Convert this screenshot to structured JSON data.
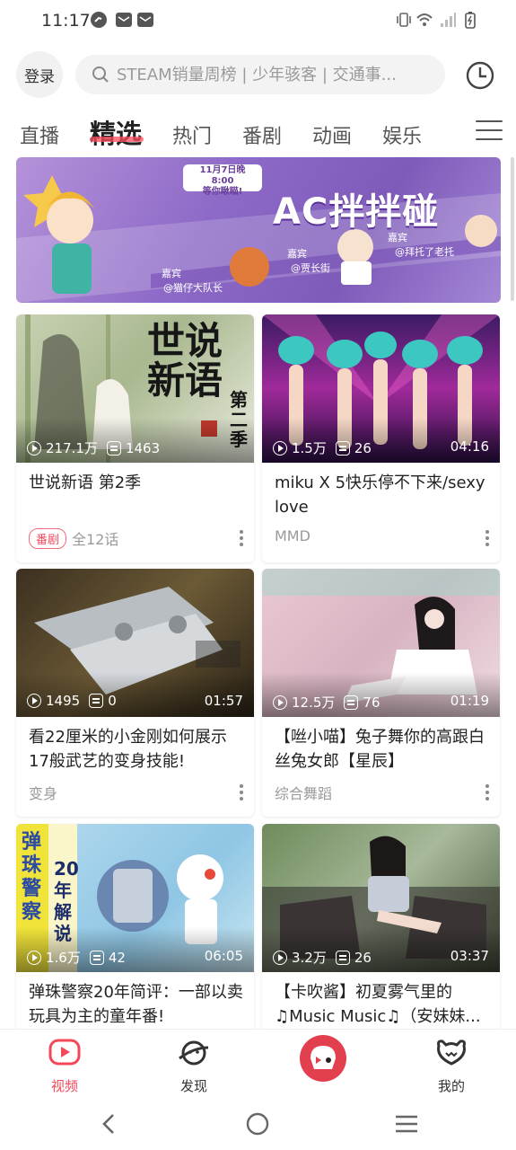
{
  "status_bar": {
    "time": "11:17"
  },
  "header": {
    "login_label": "登录",
    "search_placeholder": "STEAM销量周榜 | 少年骇客 | 交通事..."
  },
  "tabs": [
    {
      "label": "直播"
    },
    {
      "label": "精选"
    },
    {
      "label": "热门"
    },
    {
      "label": "番剧"
    },
    {
      "label": "动画"
    },
    {
      "label": "娱乐"
    }
  ],
  "banner": {
    "title": "AC拌拌碰",
    "date_text": "11月7日晚8:00\n等你瞅瞄!",
    "guest_label": "嘉宾",
    "guests": [
      "@猫仔大队长",
      "@贾长街",
      "@拜托了老托"
    ]
  },
  "cards": [
    {
      "title": "世说新语 第2季",
      "views": "217.1万",
      "danmaku": "1463",
      "duration": "",
      "badge": "番剧",
      "meta": "全12话",
      "thumb_text": "世说新语",
      "thumb_sub": "第二季"
    },
    {
      "title": "miku X 5快乐停不下来/sexy love",
      "views": "1.5万",
      "danmaku": "26",
      "duration": "04:16",
      "badge": "",
      "meta": "MMD"
    },
    {
      "title": "看22厘米的小金刚如何展示17般武艺的变身技能!",
      "views": "1495",
      "danmaku": "0",
      "duration": "01:57",
      "badge": "",
      "meta": "变身"
    },
    {
      "title": "【咝小喵】兔子舞你的高跟白丝兔女郎【星辰】",
      "views": "12.5万",
      "danmaku": "76",
      "duration": "01:19",
      "badge": "",
      "meta": "综合舞蹈"
    },
    {
      "title": "弹珠警察20年简评：一部以卖玩具为主的童年番!",
      "views": "1.6万",
      "danmaku": "42",
      "duration": "06:05",
      "badge": "",
      "meta": "",
      "thumb_text": "弹珠警察",
      "thumb_sub": "20年解说"
    },
    {
      "title": "【卡吹酱】初夏雾气里的♫Music Music♫（安妹妹...",
      "views": "3.2万",
      "danmaku": "26",
      "duration": "03:37",
      "badge": "",
      "meta": ""
    }
  ],
  "bottom_nav": [
    {
      "label": "视频"
    },
    {
      "label": "发现"
    },
    {
      "label": ""
    },
    {
      "label": "我的"
    }
  ],
  "colors": {
    "accent": "#f4485a",
    "banner": "#8d6ac7"
  },
  "icons": [
    "search-icon",
    "history-icon",
    "menu-icon",
    "video-icon",
    "planet-icon",
    "mascot-icon",
    "profile-icon",
    "back-icon",
    "home-icon",
    "recents-icon"
  ]
}
